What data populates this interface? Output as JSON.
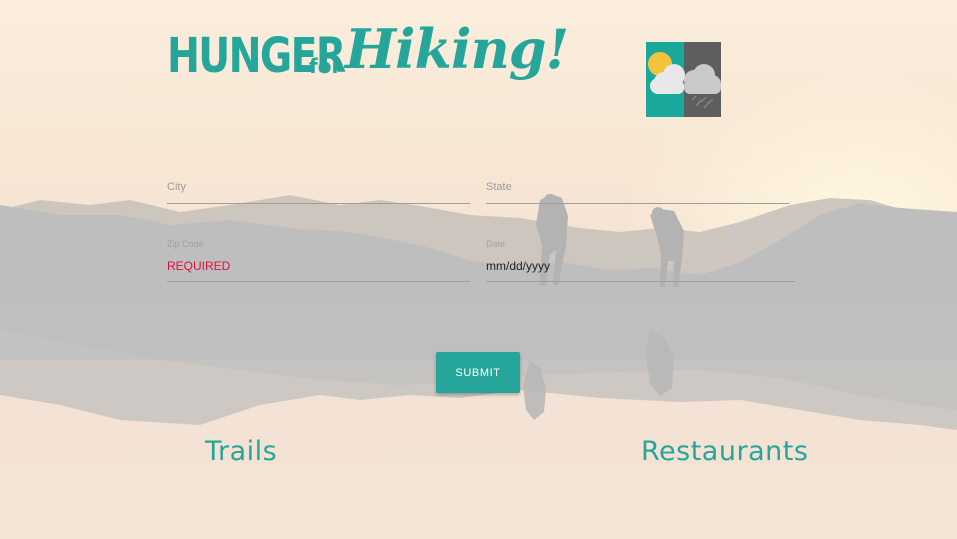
{
  "brand": {
    "word1": "HUNGER",
    "word2": "for",
    "word3": "Hiking!"
  },
  "weather_icon": "partly-cloudy-rain-icon",
  "form": {
    "city": {
      "label": "City",
      "value": ""
    },
    "state": {
      "label": "State",
      "value": ""
    },
    "zip": {
      "label": "Zip Code",
      "value": "REQUIRED"
    },
    "date": {
      "label": "Date",
      "value": "mm/dd/yyyy"
    }
  },
  "submit_label": "SUBMIT",
  "nav": {
    "trails": "Trails",
    "restaurants": "Restaurants"
  },
  "colors": {
    "accent": "#26a69a",
    "required": "#e0103a",
    "field_line": "#9e9e9e"
  }
}
